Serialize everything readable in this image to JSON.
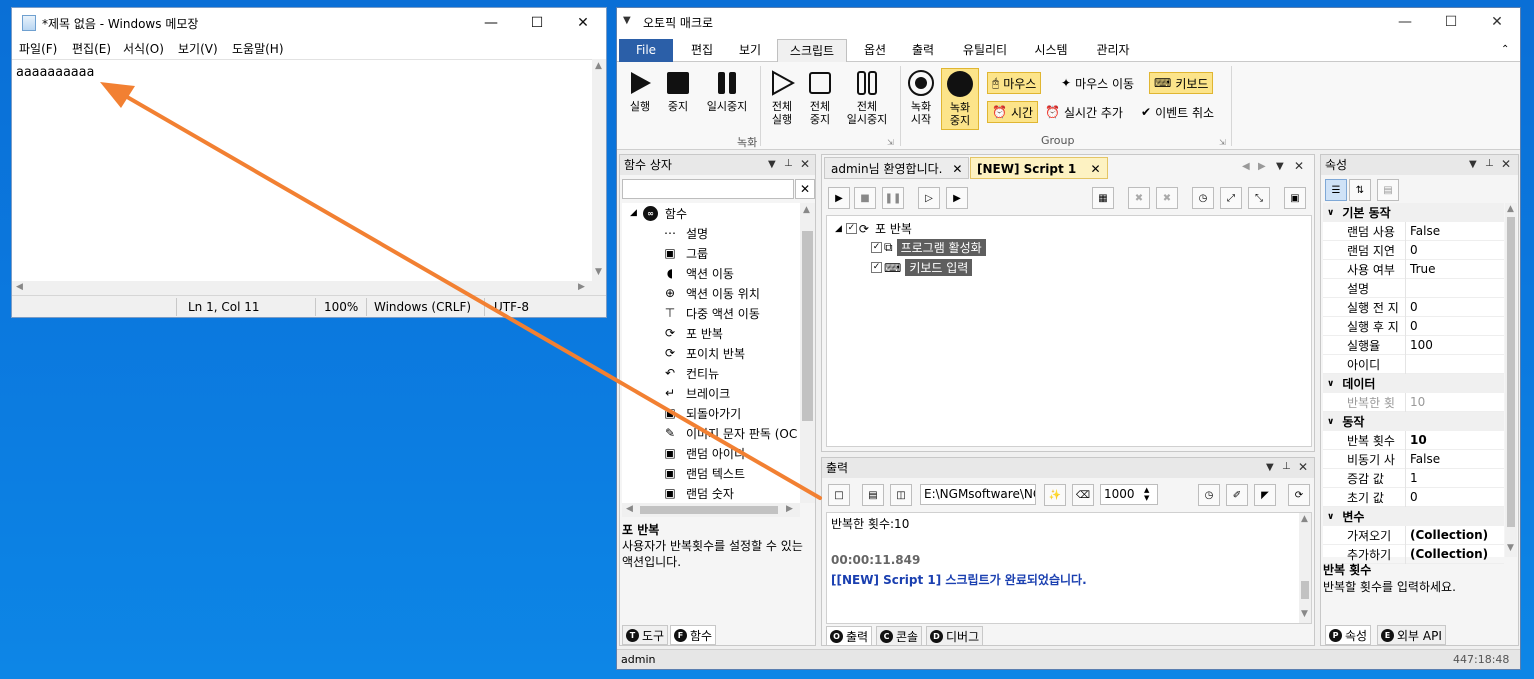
{
  "notepad": {
    "title": "*제목 없음 - Windows 메모장",
    "menu": [
      "파일(F)",
      "편집(E)",
      "서식(O)",
      "보기(V)",
      "도움말(H)"
    ],
    "content": "aaaaaaaaaa",
    "status": {
      "position": "Ln 1, Col 11",
      "zoom": "100%",
      "line_ending": "Windows (CRLF)",
      "encoding": "UTF-8"
    }
  },
  "app": {
    "title": "오토픽 매크로",
    "tabs": [
      "File",
      "편집",
      "보기",
      "스크립트",
      "옵션",
      "출력",
      "유틸리티",
      "시스템",
      "관리자"
    ],
    "active_tab": "스크립트",
    "ribbon": {
      "run": "실행",
      "stop": "중지",
      "pause": "일시중지",
      "run_all_1": "전체",
      "run_all_2": "실행",
      "stop_all_1": "전체",
      "stop_all_2": "중지",
      "pause_all_1": "전체",
      "pause_all_2": "일시중지",
      "group_record": "녹화",
      "rec_start_1": "녹화",
      "rec_start_2": "시작",
      "rec_stop_1": "녹화",
      "rec_stop_2": "중지",
      "mouse": "마우스",
      "mouse_move": "마우스 이동",
      "keyboard": "키보드",
      "time": "시간",
      "realtime_add": "실시간 추가",
      "event_cancel": "이벤트 취소",
      "group_group": "Group"
    },
    "func_panel": {
      "title": "함수 상자",
      "root": "함수",
      "items": [
        "설명",
        "그룹",
        "액션 이동",
        "액션 이동 위치",
        "다중 액션 이동",
        "포 반복",
        "포이치 반복",
        "컨티뉴",
        "브레이크",
        "되돌아가기",
        "이미지 문자 판독 (OC",
        "랜덤 아이디",
        "랜덤 텍스트",
        "랜덤 숫자"
      ],
      "desc_title": "포 반복",
      "desc_text": "사용자가 반복횟수를 설정할 수 있는 액션입니다.",
      "tab_tools": "도구",
      "tab_funcs": "함수"
    },
    "doc": {
      "tab1": "admin님 환영합니다.",
      "tab2": "[NEW] Script 1",
      "tree_root": "포 반복",
      "tree_child1": "프로그램 활성화",
      "tree_child2": "키보드 입력"
    },
    "output": {
      "title": "출력",
      "path": "E:\\NGMsoftware\\NG",
      "number": "1000",
      "line1": "반복한 횟수:10",
      "time": "00:00:11.849",
      "done": "[[NEW] Script 1] 스크립트가 완료되었습니다.",
      "tab_output": "출력",
      "tab_console": "콘솔",
      "tab_debug": "디버그"
    },
    "props": {
      "title": "속성",
      "cat_basic": "기본 동작",
      "basic": [
        {
          "k": "랜덤 사용",
          "v": "False"
        },
        {
          "k": "랜덤 지연",
          "v": "0"
        },
        {
          "k": "사용 여부",
          "v": "True"
        },
        {
          "k": "설명",
          "v": ""
        },
        {
          "k": "실행 전 지",
          "v": "0"
        },
        {
          "k": "실행 후 지",
          "v": "0"
        },
        {
          "k": "실행율",
          "v": "100"
        },
        {
          "k": "아이디",
          "v": ""
        }
      ],
      "cat_data": "데이터",
      "data_k": "반복한 횟",
      "data_v": "10",
      "cat_action": "동작",
      "action": [
        {
          "k": "반복 횟수",
          "v": "10"
        },
        {
          "k": "비동기 사",
          "v": "False"
        },
        {
          "k": "증감 값",
          "v": "1"
        },
        {
          "k": "초기 값",
          "v": "0"
        }
      ],
      "cat_var": "변수",
      "var": [
        {
          "k": "가져오기",
          "v": "(Collection)"
        },
        {
          "k": "추가하기",
          "v": "(Collection)"
        }
      ],
      "desc_title": "반복 횟수",
      "desc_text": "반복할 횟수를 입력하세요.",
      "tab_props": "속성",
      "tab_api": "외부 API"
    },
    "status_user": "admin",
    "status_time": "447:18:48"
  },
  "colors": {
    "desktop": "#0b78de",
    "arrow": "#f28032",
    "file_tab": "#2b5fa8",
    "highlight": "#fce48a"
  }
}
